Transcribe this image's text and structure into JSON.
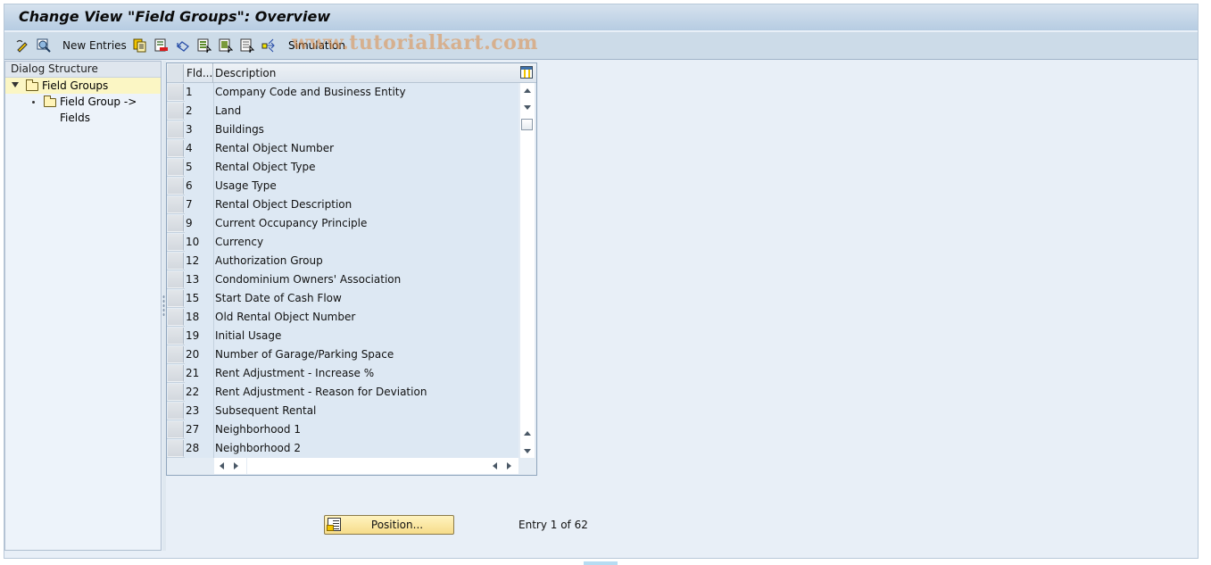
{
  "window": {
    "title": "Change View \"Field Groups\": Overview"
  },
  "toolbar": {
    "items": [
      {
        "icon": "change-display-icon",
        "label": ""
      },
      {
        "icon": "display-details-icon",
        "label": ""
      },
      {
        "icon": "new-entries-label",
        "label": "New Entries"
      },
      {
        "icon": "copy-as-icon",
        "label": ""
      },
      {
        "icon": "delete-icon",
        "label": ""
      },
      {
        "icon": "undo-change-icon",
        "label": ""
      },
      {
        "icon": "select-all-icon",
        "label": ""
      },
      {
        "icon": "select-block-icon",
        "label": ""
      },
      {
        "icon": "deselect-all-icon",
        "label": ""
      },
      {
        "icon": "simulation-icon",
        "label": "Simulation"
      }
    ],
    "new_entries_label": "New Entries",
    "simulation_label": "Simulation"
  },
  "watermark": "www.tutorialkart.com",
  "dialog_structure": {
    "header": "Dialog Structure",
    "nodes": [
      {
        "label": "Field Groups",
        "level": 0,
        "expanded": true,
        "selected": true
      },
      {
        "label": "Field Group -> Fields",
        "level": 1,
        "expanded": false,
        "selected": false
      }
    ]
  },
  "table": {
    "columns": {
      "fld": "Fld...",
      "description": "Description"
    },
    "rows": [
      {
        "fld": "1",
        "description": "Company Code and Business Entity"
      },
      {
        "fld": "2",
        "description": "Land"
      },
      {
        "fld": "3",
        "description": "Buildings"
      },
      {
        "fld": "4",
        "description": "Rental Object Number"
      },
      {
        "fld": "5",
        "description": "Rental Object Type"
      },
      {
        "fld": "6",
        "description": "Usage Type"
      },
      {
        "fld": "7",
        "description": "Rental Object Description"
      },
      {
        "fld": "9",
        "description": "Current Occupancy Principle"
      },
      {
        "fld": "10",
        "description": "Currency"
      },
      {
        "fld": "12",
        "description": "Authorization Group"
      },
      {
        "fld": "13",
        "description": "Condominium Owners' Association"
      },
      {
        "fld": "15",
        "description": "Start Date of Cash Flow"
      },
      {
        "fld": "18",
        "description": "Old Rental Object Number"
      },
      {
        "fld": "19",
        "description": "Initial Usage"
      },
      {
        "fld": "20",
        "description": "Number of Garage/Parking Space"
      },
      {
        "fld": "21",
        "description": "Rent Adjustment - Increase %"
      },
      {
        "fld": "22",
        "description": "Rent Adjustment - Reason for Deviation"
      },
      {
        "fld": "23",
        "description": "Subsequent Rental"
      },
      {
        "fld": "27",
        "description": "Neighborhood 1"
      },
      {
        "fld": "28",
        "description": "Neighborhood 2"
      }
    ]
  },
  "footer": {
    "position_button": "Position...",
    "entry_info": "Entry 1 of 62"
  }
}
